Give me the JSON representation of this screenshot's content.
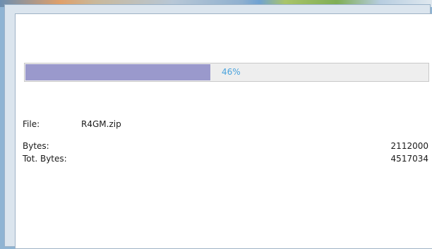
{
  "progress": {
    "percent": 46,
    "label": "46%",
    "fill_color": "#9a99cc",
    "text_color": "#4aa3dd"
  },
  "file": {
    "label": "File:",
    "name": "R4GM.zip"
  },
  "bytes": {
    "label": "Bytes:",
    "value": "2112000"
  },
  "total_bytes": {
    "label": "Tot. Bytes:",
    "value": "4517034"
  }
}
